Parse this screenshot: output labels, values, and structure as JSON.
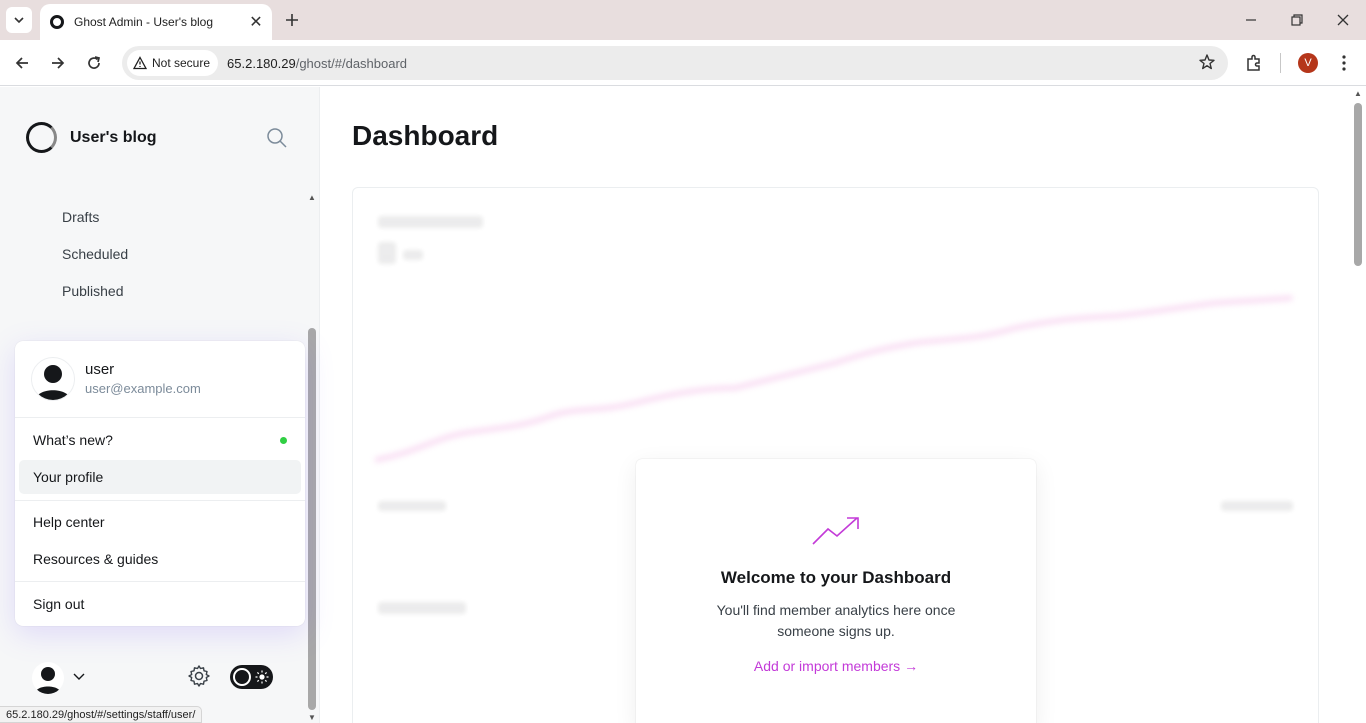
{
  "browser": {
    "tab_title": "Ghost Admin - User's blog",
    "security_label": "Not secure",
    "url_host": "65.2.180.29",
    "url_path": "/ghost/#/dashboard",
    "profile_initial": "V",
    "status_url": "65.2.180.29/ghost/#/settings/staff/user/"
  },
  "sidebar": {
    "site_title": "User's blog",
    "post_subitems": [
      {
        "label": "Drafts"
      },
      {
        "label": "Scheduled"
      },
      {
        "label": "Published"
      }
    ]
  },
  "user_menu": {
    "name": "user",
    "email": "user@example.com",
    "items": [
      {
        "label": "What’s new?",
        "has_indicator": true
      },
      {
        "label": "Your profile",
        "hovered": true
      },
      {
        "label": "Help center"
      },
      {
        "label": "Resources & guides"
      },
      {
        "label": "Sign out"
      }
    ]
  },
  "main": {
    "page_title": "Dashboard",
    "welcome": {
      "title": "Welcome to your Dashboard",
      "description": "You'll find member analytics here once someone signs up.",
      "link": "Add or import members →"
    }
  },
  "colors": {
    "accent": "#c33ad8",
    "indicator": "#30cf43",
    "sidebar_bg": "#f6f7f8"
  }
}
